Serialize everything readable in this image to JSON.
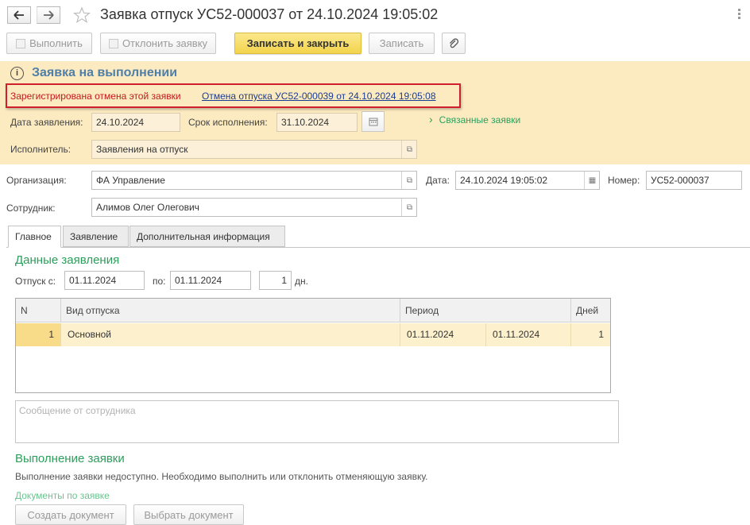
{
  "window": {
    "title": "Заявка отпуск УС52-000037 от 24.10.2024 19:05:02"
  },
  "icons": {
    "back": "arrow-left",
    "forward": "arrow-right",
    "favorite": "star-outline",
    "more": "vertical-dots",
    "info": "info-circle",
    "open": "open-window",
    "calendar": "calendar",
    "attach": "paperclip",
    "expand": "chevron-right"
  },
  "toolbar": {
    "execute": "Выполнить",
    "reject": "Отклонить заявку",
    "save_close": "Записать и закрыть",
    "save": "Записать"
  },
  "status": {
    "title": "Заявка на выполнении",
    "cancel_note": "Зарегистрирована отмена этой заявки",
    "cancel_link": "Отмена отпуска УС52-000039 от 24.10.2024 19:05:08",
    "related": "Связанные заявки",
    "date_label": "Дата заявления:",
    "date_value": "24.10.2024",
    "due_label": "Срок исполнения:",
    "due_value": "31.10.2024",
    "executor_label": "Исполнитель:",
    "executor_value": "Заявления на отпуск"
  },
  "header": {
    "org_label": "Организация:",
    "org_value": "ФА Управление",
    "date_label": "Дата:",
    "date_value": "24.10.2024 19:05:02",
    "number_label": "Номер:",
    "number_value": "УС52-000037",
    "employee_label": "Сотрудник:",
    "employee_value": "Алимов Олег Олегович"
  },
  "tabs": [
    "Главное",
    "Заявление",
    "Дополнительная информация"
  ],
  "main": {
    "section_title": "Данные заявления",
    "from_label": "Отпуск с:",
    "from_value": "01.11.2024",
    "to_label": "по:",
    "to_value": "01.11.2024",
    "days_value": "1",
    "days_unit": "дн.",
    "table": {
      "headers": [
        "N",
        "Вид отпуска",
        "Период",
        "Дней"
      ],
      "rows": [
        {
          "n": "1",
          "type": "Основной",
          "start": "01.11.2024",
          "end": "01.11.2024",
          "days": "1"
        }
      ]
    },
    "message_placeholder": "Сообщение от сотрудника",
    "exec_title": "Выполнение заявки",
    "exec_note": "Выполнение заявки недоступно. Необходимо выполнить или отклонить отменяющую заявку.",
    "docs_label": "Документы по заявке",
    "create_doc": "Создать документ",
    "select_doc": "Выбрать документ"
  }
}
